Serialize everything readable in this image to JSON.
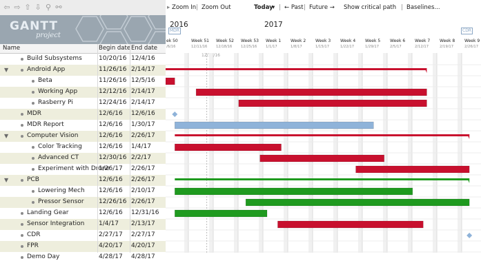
{
  "toolbar": {
    "icons": [
      "arrow-left-icon",
      "arrow-right-icon",
      "arrow-up-icon",
      "arrow-down-icon",
      "link-icon",
      "unlink-icon"
    ],
    "zoom_in": "Zoom In",
    "zoom_out": "Zoom Out",
    "today": "Today",
    "past": "← Past",
    "future": "Future →",
    "critical_path": "Show critical path",
    "baselines": "Baselines..."
  },
  "logo": {
    "title": "GANTT",
    "subtitle": "project"
  },
  "columns": {
    "name": "Name",
    "begin": "Begin date",
    "end": "End date"
  },
  "timeline": {
    "years": [
      {
        "label": "2016"
      },
      {
        "label": "2017"
      }
    ],
    "weeks": [
      {
        "label": "ek 50",
        "date": "/6/16"
      },
      {
        "label": "Week 51",
        "date": "12/11/16"
      },
      {
        "label": "Week 52",
        "date": "12/18/16"
      },
      {
        "label": "Week 53",
        "date": "12/25/16"
      },
      {
        "label": "Week 1",
        "date": "1/1/17"
      },
      {
        "label": "Week 2",
        "date": "1/8/17"
      },
      {
        "label": "Week 3",
        "date": "1/15/17"
      },
      {
        "label": "Week 4",
        "date": "1/22/17"
      },
      {
        "label": "Week 5",
        "date": "1/29/17"
      },
      {
        "label": "Week 6",
        "date": "2/5/17"
      },
      {
        "label": "Week 7",
        "date": "2/12/17"
      },
      {
        "label": "Week 8",
        "date": "2/19/17"
      },
      {
        "label": "Week 9",
        "date": "2/26/17"
      }
    ],
    "today_label": "12/15/16",
    "milestone_tags": {
      "mdr": "MDR",
      "cdr": "CDR"
    }
  },
  "tasks": [
    {
      "name": "Build Subsystems",
      "begin": "10/20/16",
      "end": "12/4/16",
      "indent": 0,
      "type": "task"
    },
    {
      "name": "Android App",
      "begin": "11/26/16",
      "end": "2/14/17",
      "indent": 0,
      "type": "group",
      "color": "#c8102e"
    },
    {
      "name": "Beta",
      "begin": "11/26/16",
      "end": "12/5/16",
      "indent": 1,
      "type": "task",
      "color": "#c8102e"
    },
    {
      "name": "Working App",
      "begin": "12/12/16",
      "end": "2/14/17",
      "indent": 1,
      "type": "task",
      "color": "#c8102e"
    },
    {
      "name": "Rasberry Pi",
      "begin": "12/24/16",
      "end": "2/14/17",
      "indent": 1,
      "type": "task",
      "color": "#c8102e"
    },
    {
      "name": "MDR",
      "begin": "12/6/16",
      "end": "12/6/16",
      "indent": 0,
      "type": "milestone",
      "color": "#8fb3d9"
    },
    {
      "name": "MDR Report",
      "begin": "12/6/16",
      "end": "1/30/17",
      "indent": 0,
      "type": "task",
      "color": "#8fb3d9"
    },
    {
      "name": "Computer Vision",
      "begin": "12/6/16",
      "end": "2/26/17",
      "indent": 0,
      "type": "group",
      "color": "#c8102e"
    },
    {
      "name": "Color Tracking",
      "begin": "12/6/16",
      "end": "1/4/17",
      "indent": 1,
      "type": "task",
      "color": "#c8102e"
    },
    {
      "name": "Advanced CT",
      "begin": "12/30/16",
      "end": "2/2/17",
      "indent": 1,
      "type": "task",
      "color": "#c8102e"
    },
    {
      "name": "Experiment with Drone",
      "begin": "1/26/17",
      "end": "2/26/17",
      "indent": 1,
      "type": "task",
      "color": "#c8102e"
    },
    {
      "name": "PCB",
      "begin": "12/6/16",
      "end": "2/26/17",
      "indent": 0,
      "type": "group",
      "color": "#1f9a1f"
    },
    {
      "name": "Lowering Mech",
      "begin": "12/6/16",
      "end": "2/10/17",
      "indent": 1,
      "type": "task",
      "color": "#1f9a1f"
    },
    {
      "name": "Pressor Sensor",
      "begin": "12/26/16",
      "end": "2/26/17",
      "indent": 1,
      "type": "task",
      "color": "#1f9a1f"
    },
    {
      "name": "Landing Gear",
      "begin": "12/6/16",
      "end": "12/31/16",
      "indent": 0,
      "type": "task",
      "color": "#1f9a1f"
    },
    {
      "name": "Sensor Integration",
      "begin": "1/4/17",
      "end": "2/13/17",
      "indent": 0,
      "type": "task",
      "color": "#c8102e"
    },
    {
      "name": "CDR",
      "begin": "2/27/17",
      "end": "2/27/17",
      "indent": 0,
      "type": "milestone",
      "color": "#8fb3d9"
    },
    {
      "name": "FPR",
      "begin": "4/20/17",
      "end": "4/20/17",
      "indent": 0,
      "type": "task"
    },
    {
      "name": "Demo Day",
      "begin": "4/28/17",
      "end": "4/28/17",
      "indent": 0,
      "type": "task"
    }
  ]
}
